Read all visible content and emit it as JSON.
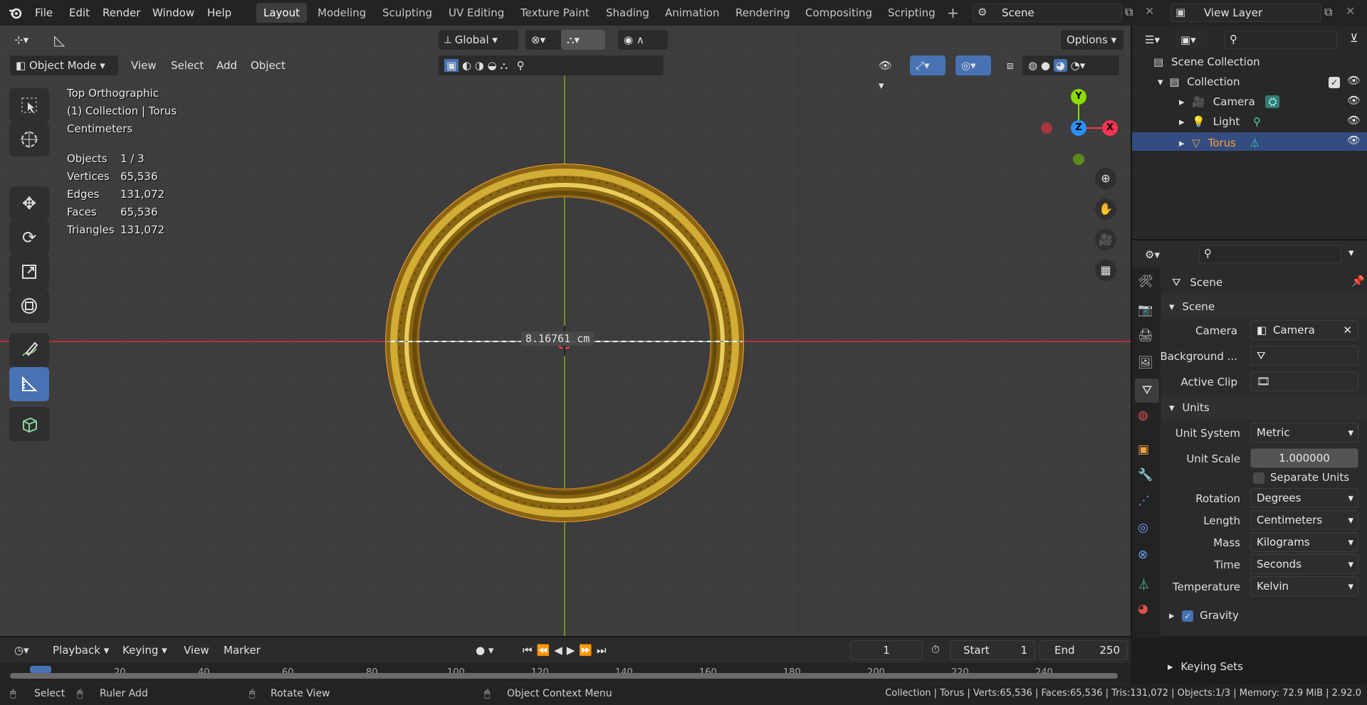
{
  "menu": [
    "File",
    "Edit",
    "Render",
    "Window",
    "Help"
  ],
  "workspaces": [
    "Layout",
    "Modeling",
    "Sculpting",
    "UV Editing",
    "Texture Paint",
    "Shading",
    "Animation",
    "Rendering",
    "Compositing",
    "Scripting"
  ],
  "scene_name": "Scene",
  "view_layer_name": "View Layer",
  "viewport_header": {
    "orientation": "Global",
    "options": "Options",
    "mode": "Object Mode",
    "menus": [
      "View",
      "Select",
      "Add",
      "Object"
    ]
  },
  "overlay": {
    "view_name": "Top Orthographic",
    "collection_line": "(1) Collection | Torus",
    "units": "Centimeters",
    "stats": [
      {
        "label": "Objects",
        "value": "1 / 3"
      },
      {
        "label": "Vertices",
        "value": "65,536"
      },
      {
        "label": "Edges",
        "value": "131,072"
      },
      {
        "label": "Faces",
        "value": "65,536"
      },
      {
        "label": "Triangles",
        "value": "131,072"
      }
    ]
  },
  "measurement": "8.16761 cm",
  "gizmo": {
    "y": "Y",
    "z": "Z",
    "x": "X"
  },
  "outliner": {
    "root": "Scene Collection",
    "collection": "Collection",
    "items": [
      "Camera",
      "Light",
      "Torus"
    ]
  },
  "properties": {
    "header": "Scene",
    "panel_scene": "Scene",
    "camera_label": "Camera",
    "camera_value": "Camera",
    "background_label": "Background ...",
    "active_clip_label": "Active Clip",
    "panel_units": "Units",
    "unit_system_label": "Unit System",
    "unit_system_value": "Metric",
    "unit_scale_label": "Unit Scale",
    "unit_scale_value": "1.000000",
    "separate_units": "Separate Units",
    "rotation_label": "Rotation",
    "rotation_value": "Degrees",
    "length_label": "Length",
    "length_value": "Centimeters",
    "mass_label": "Mass",
    "mass_value": "Kilograms",
    "time_label": "Time",
    "time_value": "Seconds",
    "temperature_label": "Temperature",
    "temperature_value": "Kelvin",
    "gravity": "Gravity",
    "keying_sets": "Keying Sets"
  },
  "timeline": {
    "playback": "Playback",
    "keying": "Keying",
    "view": "View",
    "marker": "Marker",
    "current_frame": "1",
    "start_label": "Start",
    "start_value": "1",
    "end_label": "End",
    "end_value": "250",
    "ruler": [
      "1",
      "20",
      "40",
      "60",
      "80",
      "100",
      "120",
      "140",
      "160",
      "180",
      "200",
      "220",
      "240"
    ]
  },
  "statusbar": {
    "select": "Select",
    "ruler_add": "Ruler Add",
    "rotate_view": "Rotate View",
    "context_menu": "Object Context Menu",
    "info": "Collection | Torus | Verts:65,536 | Faces:65,536 | Tris:131,072 | Objects:1/3 | Memory: 72.9 MiB | 2.92.0"
  },
  "colors": {
    "accent": "#4772b3",
    "x_axis": "#ff3352",
    "y_axis": "#8bdc00",
    "z_axis": "#2890ff",
    "selected_orange": "#ffa033",
    "gold": "#c9a227"
  }
}
